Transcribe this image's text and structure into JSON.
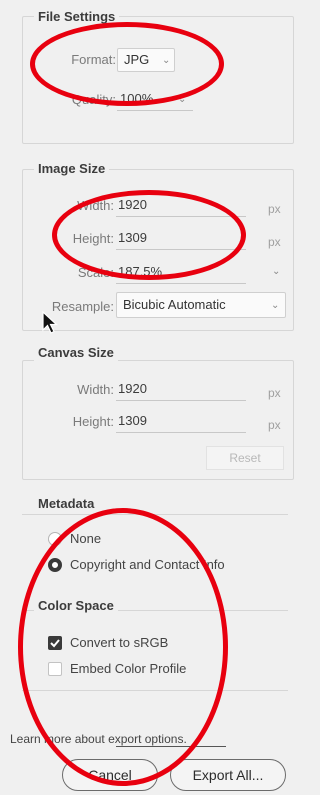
{
  "file_settings": {
    "legend": "File Settings",
    "format_label": "Format:",
    "format_value": "JPG",
    "quality_label": "Quality:",
    "quality_value": "100%"
  },
  "image_size": {
    "legend": "Image Size",
    "width_label": "Width:",
    "width_value": "1920",
    "height_label": "Height:",
    "height_value": "1309",
    "scale_label": "Scale:",
    "scale_value": "187.5%",
    "unit": "px",
    "resample_label": "Resample:",
    "resample_value": "Bicubic Automatic"
  },
  "canvas_size": {
    "legend": "Canvas Size",
    "width_label": "Width:",
    "width_value": "1920",
    "height_label": "Height:",
    "height_value": "1309",
    "unit": "px",
    "reset_label": "Reset"
  },
  "metadata": {
    "legend": "Metadata",
    "options": [
      "None",
      "Copyright and Contact Info"
    ],
    "selected": "Copyright and Contact Info"
  },
  "color_space": {
    "legend": "Color Space",
    "convert_label": "Convert to sRGB",
    "convert_checked": true,
    "embed_label": "Embed Color Profile",
    "embed_checked": false
  },
  "footer": {
    "learn_more": "Learn more about export options.",
    "cancel_label": "Cancel",
    "export_label": "Export All..."
  },
  "colors": {
    "annotation": "#e8000f",
    "panel_bg": "#f0f0f0"
  },
  "icons": {
    "dropdown": "chevron-down-icon",
    "cursor": "mouse-pointer-icon"
  }
}
